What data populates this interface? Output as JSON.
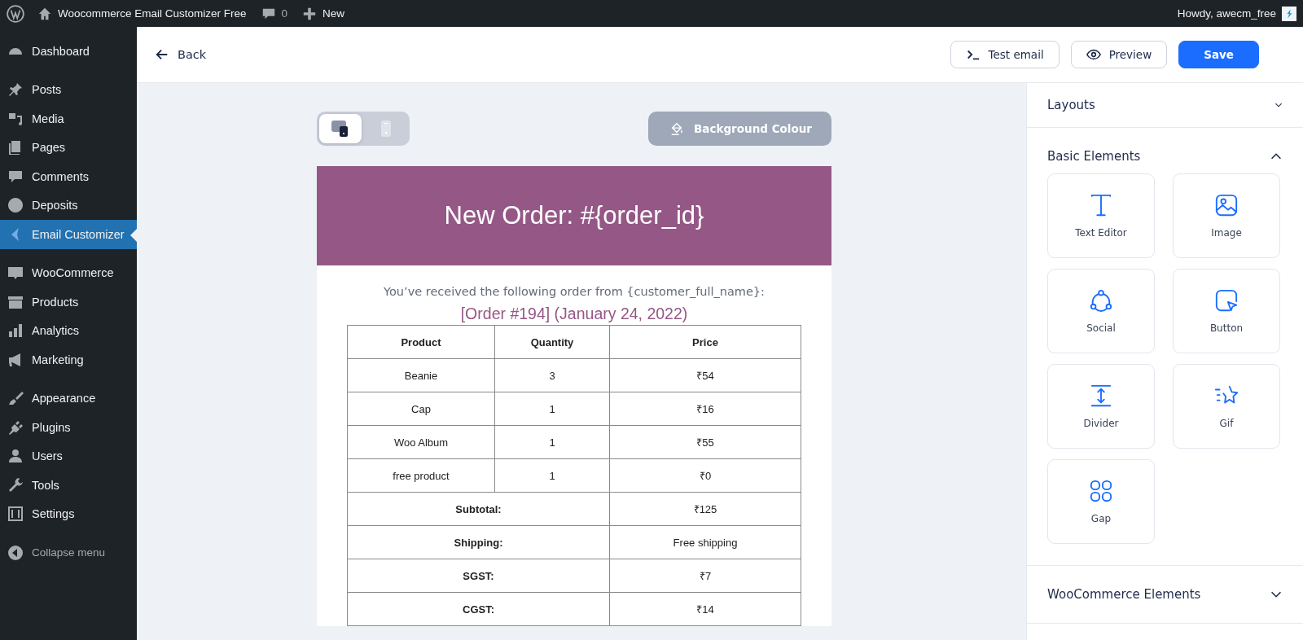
{
  "admin_bar": {
    "site_title": "Woocommerce Email Customizer Free",
    "comments_count": "0",
    "new_label": "New",
    "greeting": "Howdy, awecm_free"
  },
  "sidebar": {
    "groups": [
      {
        "items": [
          {
            "label": "Dashboard",
            "selected": false
          }
        ]
      },
      {
        "items": [
          {
            "label": "Posts",
            "selected": false
          },
          {
            "label": "Media",
            "selected": false
          },
          {
            "label": "Pages",
            "selected": false
          },
          {
            "label": "Comments",
            "selected": false
          },
          {
            "label": "Deposits",
            "selected": false
          },
          {
            "label": "Email Customizer",
            "selected": true
          }
        ]
      },
      {
        "items": [
          {
            "label": "WooCommerce",
            "selected": false
          },
          {
            "label": "Products",
            "selected": false
          },
          {
            "label": "Analytics",
            "selected": false
          },
          {
            "label": "Marketing",
            "selected": false
          }
        ]
      },
      {
        "items": [
          {
            "label": "Appearance",
            "selected": false
          },
          {
            "label": "Plugins",
            "selected": false
          },
          {
            "label": "Users",
            "selected": false
          },
          {
            "label": "Tools",
            "selected": false
          },
          {
            "label": "Settings",
            "selected": false
          }
        ]
      }
    ],
    "collapse_label": "Collapse menu"
  },
  "header": {
    "back_label": "Back",
    "buttons": [
      {
        "label": "Test email",
        "kind": "terminal"
      },
      {
        "label": "Preview",
        "kind": "eye"
      },
      {
        "label": "Save",
        "kind": "primary"
      }
    ]
  },
  "canvas": {
    "devices": [
      {
        "kind": "desktop",
        "selected": true
      },
      {
        "kind": "mobile",
        "selected": false
      }
    ],
    "background_button": "Background Colour",
    "email": {
      "heading": "New Order: #{order_id}",
      "intro": "You’ve received the following order from {customer_full_name}:",
      "order_title": "[Order #194] (January 24, 2022)",
      "table": {
        "columns": [
          "Product",
          "Quantity",
          "Price"
        ],
        "items": [
          {
            "product": "Beanie",
            "quantity": "3",
            "price": "₹54"
          },
          {
            "product": "Cap",
            "quantity": "1",
            "price": "₹16"
          },
          {
            "product": "Woo Album",
            "quantity": "1",
            "price": "₹55"
          },
          {
            "product": "free product",
            "quantity": "1",
            "price": "₹0"
          }
        ],
        "totals": [
          {
            "label": "Subtotal:",
            "value": "₹125"
          },
          {
            "label": "Shipping:",
            "value": "Free shipping"
          },
          {
            "label": "SGST:",
            "value": "₹7"
          },
          {
            "label": "CGST:",
            "value": "₹14"
          }
        ]
      }
    }
  },
  "panel": {
    "sections": [
      {
        "title": "Layouts",
        "expanded": false
      },
      {
        "title": "Basic Elements",
        "expanded": true,
        "elements": [
          {
            "label": "Text Editor",
            "kind": "text"
          },
          {
            "label": "Image",
            "kind": "image"
          },
          {
            "label": "Social",
            "kind": "social"
          },
          {
            "label": "Button",
            "kind": "button"
          },
          {
            "label": "Divider",
            "kind": "divider"
          },
          {
            "label": "Gif",
            "kind": "gif"
          },
          {
            "label": "Gap",
            "kind": "gap"
          }
        ]
      },
      {
        "title": "WooCommerce Elements",
        "expanded": false
      }
    ]
  }
}
